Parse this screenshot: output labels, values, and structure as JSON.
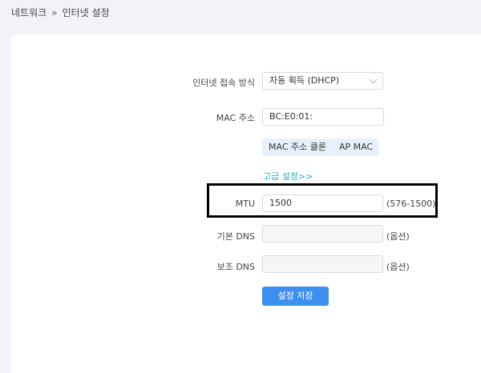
{
  "breadcrumb": {
    "parent": "네트워크",
    "separator": "»",
    "current": "인터넷 설정"
  },
  "form": {
    "connection_label": "인터넷 접속 방식",
    "connection_value": "자동 획득 (DHCP)",
    "mac_label": "MAC 주소",
    "mac_value": "BC:E0:01:",
    "mac_clone_button": "MAC 주소 클론",
    "ap_mac_button": "AP MAC",
    "advanced_link": "고급 설정>>",
    "mtu_label": "MTU",
    "mtu_value": "1500",
    "mtu_range": "(576-1500)",
    "dns1_label": "기본 DNS",
    "dns1_value": "",
    "dns1_hint": "(옵션)",
    "dns2_label": "보조 DNS",
    "dns2_value": "",
    "dns2_hint": "(옵션)",
    "save_button": "설정 저장"
  },
  "colors": {
    "primary": "#3d8ff0",
    "link": "#2bb3c0",
    "light_button": "#e8f1fb",
    "background": "#f1f3f6"
  }
}
